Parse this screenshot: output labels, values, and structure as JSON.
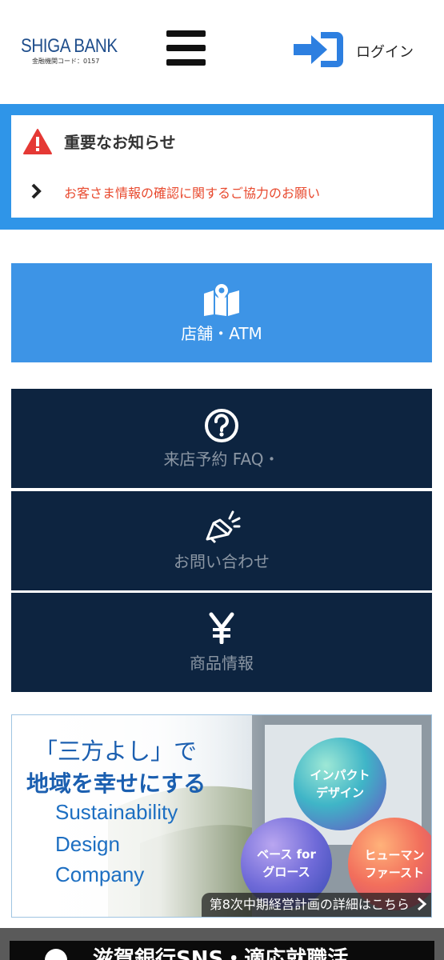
{
  "header": {
    "logo_name": "SHIGA BANK",
    "logo_sub": "金融機関コード：0157",
    "menu_icon": "hamburger-menu-icon",
    "login_icon": "login-arrow-icon",
    "login_label": "ログイン"
  },
  "notice": {
    "title": "重要なお知らせ",
    "icon": "warning-triangle-icon",
    "link_text": "お客さま情報の確認に関するご協力のお願い"
  },
  "tiles": [
    {
      "label": "店舗・ATM",
      "icon": "map-pin-icon"
    },
    {
      "label": "来店予約 FAQ・",
      "icon": "question-circle-icon"
    },
    {
      "label": "お問い合わせ",
      "icon": "megaphone-icon"
    },
    {
      "label": "商品情報",
      "icon": "yen-icon"
    }
  ],
  "banner": {
    "line1": "「三方よし」で",
    "line2": "地域を幸せにする",
    "en": [
      "Sustainability",
      "Design",
      "Company"
    ],
    "circles": [
      [
        "インパクト",
        "デザイン"
      ],
      [
        "ベース for",
        "グロース"
      ],
      [
        "ヒューマン",
        "ファースト"
      ]
    ],
    "caption": "第8次中期経営計画の詳細はこちら"
  },
  "bottom": {
    "text": "滋賀銀行SNS・適応就職活"
  },
  "colors": {
    "brand_blue": "#3d94e6",
    "notice_border": "#2f95e8",
    "navy": "#0d2440",
    "alert_red": "#e8492e"
  }
}
